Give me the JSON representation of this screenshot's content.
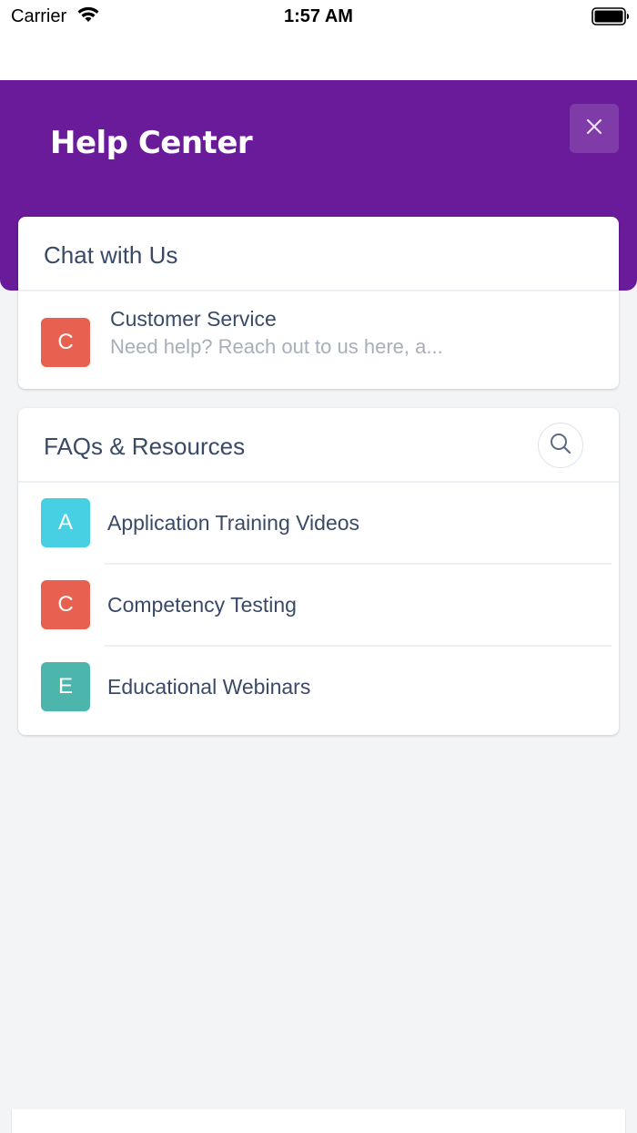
{
  "status_bar": {
    "carrier": "Carrier",
    "time": "1:57 AM",
    "wifi_icon": "wifi-icon",
    "battery_icon": "battery-icon"
  },
  "header": {
    "title": "Help Center",
    "close_icon": "close-icon",
    "background_color": "#6a1b9a"
  },
  "chat_card": {
    "title": "Chat with Us",
    "items": [
      {
        "avatar_letter": "C",
        "avatar_color": "#e8604f",
        "title": "Customer Service",
        "subtitle": "Need help? Reach out to us here, a..."
      }
    ]
  },
  "faq_card": {
    "title": "FAQs & Resources",
    "search_icon": "search-icon",
    "items": [
      {
        "avatar_letter": "A",
        "avatar_color": "#47cfe4",
        "label": "Application Training Videos"
      },
      {
        "avatar_letter": "C",
        "avatar_color": "#e8604f",
        "label": "Competency Testing"
      },
      {
        "avatar_letter": "E",
        "avatar_color": "#4db6ac",
        "label": "Educational Webinars"
      }
    ]
  }
}
